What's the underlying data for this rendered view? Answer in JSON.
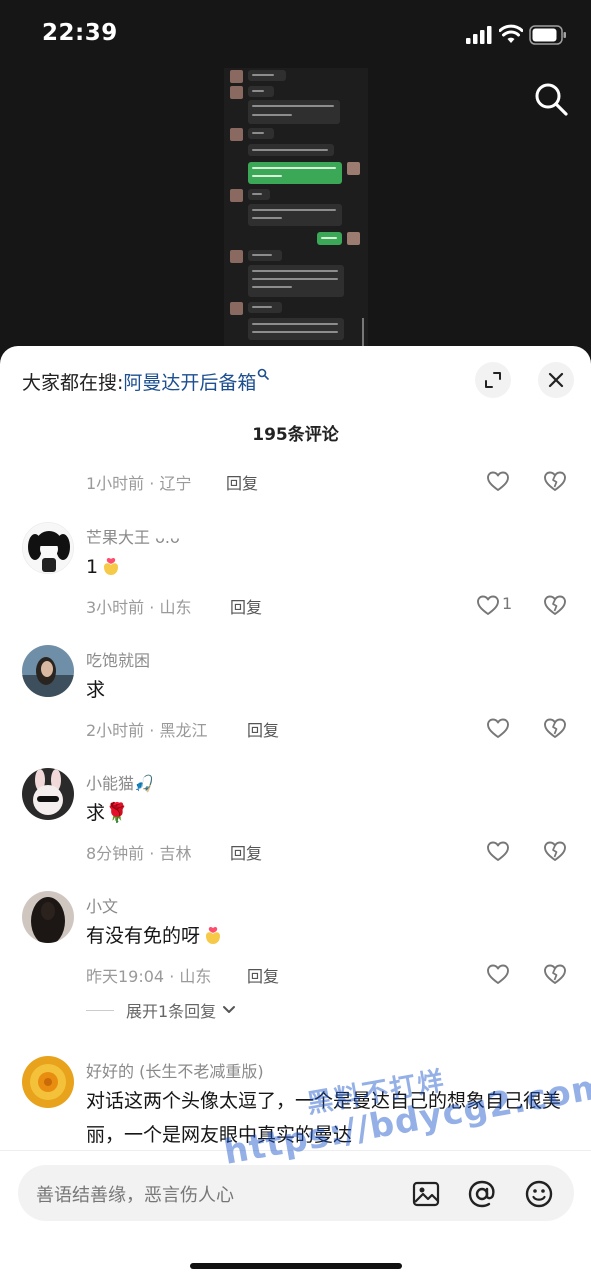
{
  "status_bar": {
    "time": "22:39"
  },
  "sheet": {
    "trending_label": "大家都在搜:",
    "trending_keyword": "阿曼达开后备箱",
    "comment_count": "195条评论"
  },
  "comments": [
    {
      "meta": "1小时前 · 辽宁",
      "reply": "回复"
    },
    {
      "username": "芒果大王 ᴗ.ᴗ",
      "text": "1",
      "meta": "3小时前 · 山东",
      "reply": "回复",
      "likes": "1"
    },
    {
      "username": "吃饱就困",
      "text": "求",
      "meta": "2小时前 · 黑龙江",
      "reply": "回复"
    },
    {
      "username": "小能猫🎣",
      "text": "求🌹",
      "meta": "8分钟前 · 吉林",
      "reply": "回复"
    },
    {
      "username": "小文",
      "text": "有没有免的呀",
      "meta": "昨天19:04 · 山东",
      "reply": "回复"
    },
    {
      "username": "好好的 (长生不老减重版)",
      "text": "对话这两个头像太逗了，一个是曼达自己的想象自己很美丽，一个是网友眼中真实的曼达"
    }
  ],
  "expand_replies": "展开1条回复",
  "input": {
    "placeholder": "善语结善缘，恶言伤人心"
  },
  "watermark": {
    "line1": "黑料不打烊",
    "line2": "https://bdycg2.com"
  },
  "icons": [
    "signal-icon",
    "wifi-icon",
    "battery-icon",
    "search-icon",
    "expand-icon",
    "close-icon",
    "heart-icon",
    "broken-heart-icon",
    "image-icon",
    "at-icon",
    "smile-icon",
    "chevron-down-icon"
  ]
}
